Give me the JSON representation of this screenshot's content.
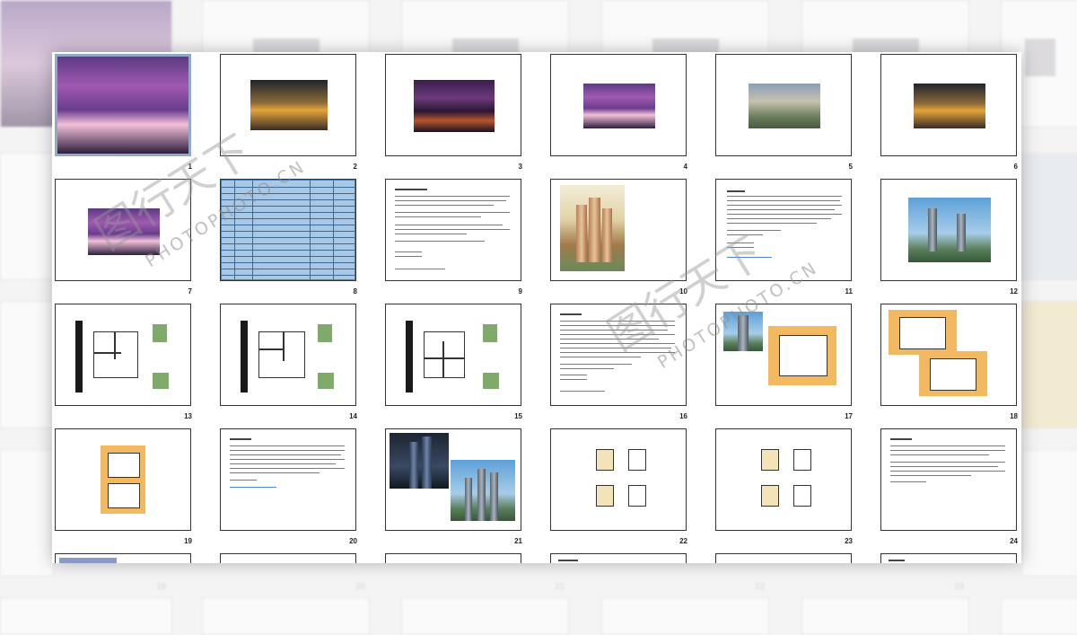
{
  "slide_numbers": [
    "1",
    "2",
    "3",
    "4",
    "5",
    "6",
    "7",
    "8",
    "9",
    "10",
    "11",
    "12",
    "13",
    "14",
    "15",
    "16",
    "17",
    "18",
    "19",
    "20",
    "21",
    "22",
    "23",
    "24"
  ],
  "background_numbers": [
    "19",
    "20",
    "21",
    "22",
    "23"
  ],
  "watermark": {
    "text": "PHOTOPHOTO.CN",
    "chars": "图行天下"
  },
  "colors": {
    "selected_border": "#8fa9c9",
    "slide_border": "#333333",
    "table_fill": "#a9c8e6",
    "plan_fill": "#f2b960"
  }
}
